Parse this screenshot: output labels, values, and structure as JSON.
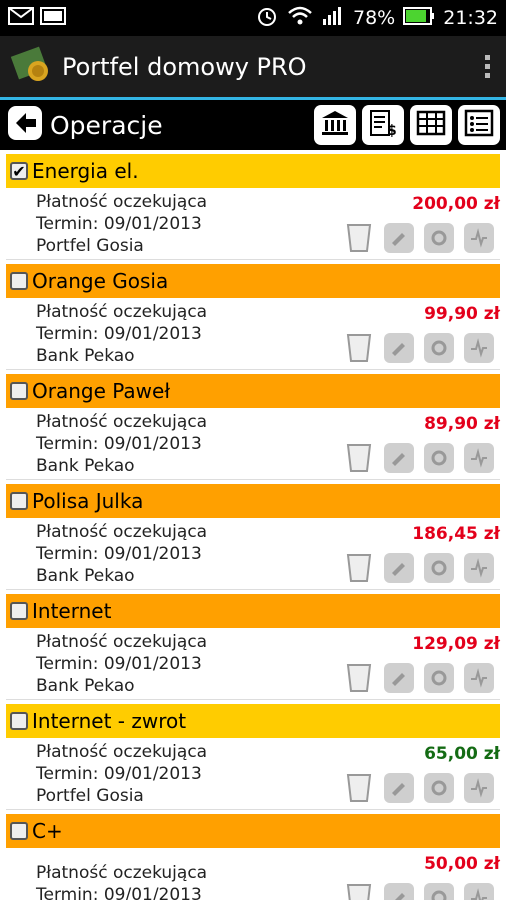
{
  "statusbar": {
    "battery": "78%",
    "time": "21:32"
  },
  "app": {
    "title": "Portfel domowy PRO"
  },
  "subheader": {
    "title": "Operacje"
  },
  "items": [
    {
      "name": "Energia el.",
      "checked": true,
      "status": "Płatność oczekująca",
      "termin": "Termin: 09/01/2013",
      "account": "Portfel Gosia",
      "amount": "200,00 zł",
      "amount_color": "red",
      "header_color": "yellow"
    },
    {
      "name": "Orange Gosia",
      "checked": false,
      "status": "Płatność oczekująca",
      "termin": "Termin: 09/01/2013",
      "account": "Bank Pekao",
      "amount": "99,90 zł",
      "amount_color": "red",
      "header_color": "orange"
    },
    {
      "name": "Orange Paweł",
      "checked": false,
      "status": "Płatność oczekująca",
      "termin": "Termin: 09/01/2013",
      "account": "Bank Pekao",
      "amount": "89,90 zł",
      "amount_color": "red",
      "header_color": "orange"
    },
    {
      "name": "Polisa Julka",
      "checked": false,
      "status": "Płatność oczekująca",
      "termin": "Termin: 09/01/2013",
      "account": "Bank Pekao",
      "amount": "186,45 zł",
      "amount_color": "red",
      "header_color": "orange"
    },
    {
      "name": "Internet",
      "checked": false,
      "status": "Płatność oczekująca",
      "termin": "Termin: 09/01/2013",
      "account": "Bank Pekao",
      "amount": "129,09 zł",
      "amount_color": "red",
      "header_color": "orange"
    },
    {
      "name": "Internet - zwrot",
      "checked": false,
      "status": "Płatność oczekująca",
      "termin": "Termin: 09/01/2013",
      "account": "Portfel Gosia",
      "amount": "65,00 zł",
      "amount_color": "green",
      "header_color": "yellow"
    },
    {
      "name": "C+",
      "checked": false,
      "status": "Płatność oczekująca",
      "termin": "Termin: 09/01/2013",
      "account": "",
      "amount": "50,00 zł",
      "amount_color": "red",
      "header_color": "orange"
    }
  ],
  "colors": {
    "accent": "#33b5e5",
    "header_yellow": "#ffcc00",
    "header_orange": "#ffa000",
    "amount_red": "#e3001b",
    "amount_green": "#146b14"
  }
}
